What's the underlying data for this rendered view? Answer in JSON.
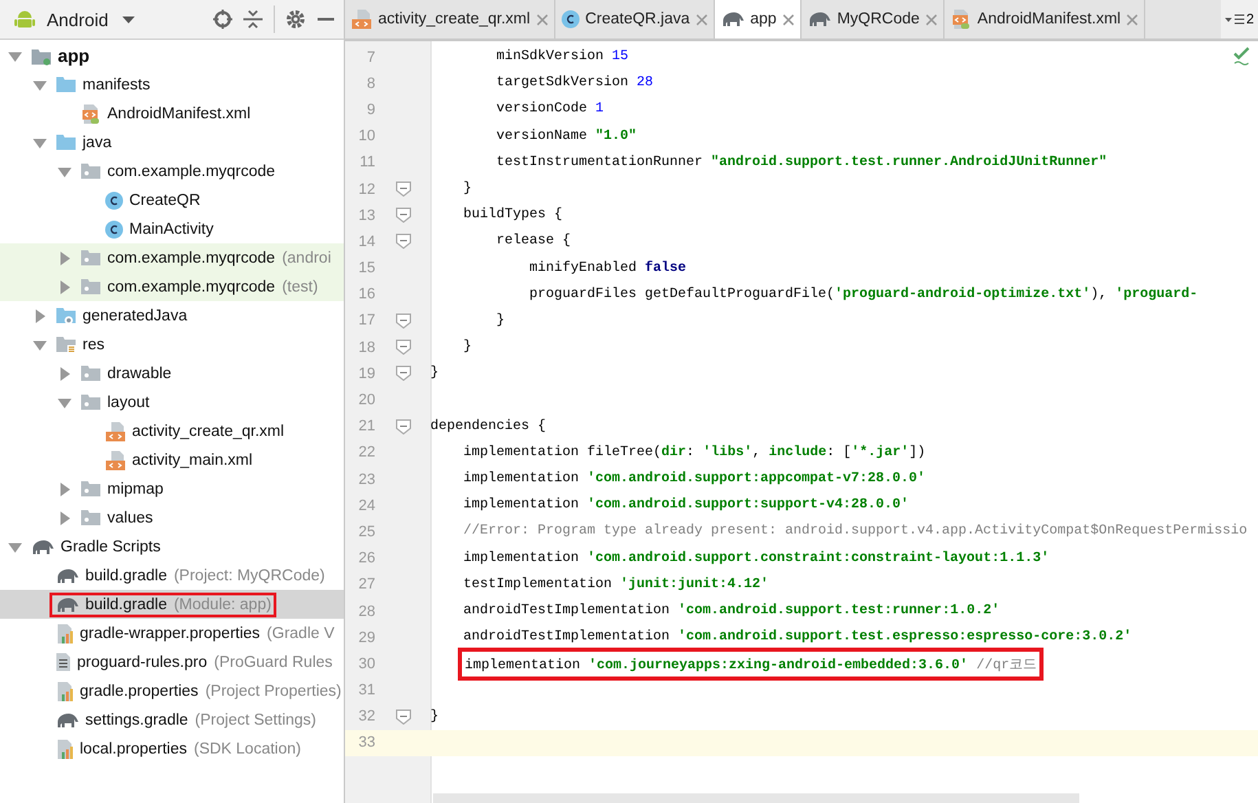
{
  "project_panel": {
    "view": "Android"
  },
  "tree": [
    {
      "label": "app",
      "kind": "module",
      "expanded": true,
      "selected": false,
      "highlighted": false,
      "boxed": false,
      "children": [
        {
          "label": "manifests",
          "kind": "folder-blue",
          "expanded": true,
          "selected": false,
          "highlighted": false,
          "boxed": false,
          "children": [
            {
              "label": "AndroidManifest.xml",
              "kind": "manifest",
              "selected": false,
              "highlighted": false,
              "boxed": false
            }
          ]
        },
        {
          "label": "java",
          "kind": "folder-blue",
          "expanded": true,
          "selected": false,
          "highlighted": false,
          "boxed": false,
          "children": [
            {
              "label": "com.example.myqrcode",
              "kind": "package",
              "expanded": true,
              "selected": false,
              "highlighted": false,
              "boxed": false,
              "children": [
                {
                  "label": "CreateQR",
                  "kind": "class",
                  "selected": false,
                  "highlighted": false,
                  "boxed": false
                },
                {
                  "label": "MainActivity",
                  "kind": "class",
                  "selected": false,
                  "highlighted": false,
                  "boxed": false
                }
              ]
            },
            {
              "label": "com.example.myqrcode",
              "hint": "(androi",
              "kind": "package",
              "expanded": false,
              "selected": false,
              "highlighted": true,
              "boxed": false
            },
            {
              "label": "com.example.myqrcode",
              "hint": "(test)",
              "kind": "package",
              "expanded": false,
              "selected": false,
              "highlighted": true,
              "boxed": false
            }
          ]
        },
        {
          "label": "generatedJava",
          "kind": "folder-gen",
          "expanded": false,
          "selected": false,
          "highlighted": false,
          "boxed": false
        },
        {
          "label": "res",
          "kind": "folder-res",
          "expanded": true,
          "selected": false,
          "highlighted": false,
          "boxed": false,
          "children": [
            {
              "label": "drawable",
              "kind": "package",
              "expanded": false,
              "selected": false,
              "highlighted": false,
              "boxed": false
            },
            {
              "label": "layout",
              "kind": "package",
              "expanded": true,
              "selected": false,
              "highlighted": false,
              "boxed": false,
              "children": [
                {
                  "label": "activity_create_qr.xml",
                  "kind": "xml",
                  "selected": false,
                  "highlighted": false,
                  "boxed": false
                },
                {
                  "label": "activity_main.xml",
                  "kind": "xml",
                  "selected": false,
                  "highlighted": false,
                  "boxed": false
                }
              ]
            },
            {
              "label": "mipmap",
              "kind": "package",
              "expanded": false,
              "selected": false,
              "highlighted": false,
              "boxed": false
            },
            {
              "label": "values",
              "kind": "package",
              "expanded": false,
              "selected": false,
              "highlighted": false,
              "boxed": false
            }
          ]
        }
      ]
    },
    {
      "label": "Gradle Scripts",
      "kind": "gradle",
      "expanded": true,
      "selected": false,
      "highlighted": false,
      "boxed": false,
      "children": [
        {
          "label": "build.gradle",
          "hint": "(Project: MyQRCode)",
          "kind": "gradle",
          "selected": false,
          "highlighted": false,
          "boxed": false
        },
        {
          "label": "build.gradle",
          "hint": "(Module: app)",
          "kind": "gradle",
          "selected": true,
          "highlighted": false,
          "boxed": true
        },
        {
          "label": "gradle-wrapper.properties",
          "hint": "(Gradle V",
          "kind": "props",
          "selected": false,
          "highlighted": false,
          "boxed": false
        },
        {
          "label": "proguard-rules.pro",
          "hint": "(ProGuard Rules",
          "kind": "text",
          "selected": false,
          "highlighted": false,
          "boxed": false
        },
        {
          "label": "gradle.properties",
          "hint": "(Project Properties)",
          "kind": "props",
          "selected": false,
          "highlighted": false,
          "boxed": false
        },
        {
          "label": "settings.gradle",
          "hint": "(Project Settings)",
          "kind": "gradle",
          "selected": false,
          "highlighted": false,
          "boxed": false
        },
        {
          "label": "local.properties",
          "hint": "(SDK Location)",
          "kind": "props",
          "selected": false,
          "highlighted": false,
          "boxed": false
        }
      ]
    }
  ],
  "tabs": [
    {
      "label": "activity_create_qr.xml",
      "kind": "xml",
      "selected": false
    },
    {
      "label": "CreateQR.java",
      "kind": "class",
      "selected": false
    },
    {
      "label": "app",
      "kind": "gradle",
      "selected": true
    },
    {
      "label": "MyQRCode",
      "kind": "gradle",
      "selected": false
    },
    {
      "label": "AndroidManifest.xml",
      "kind": "manifest",
      "selected": false
    }
  ],
  "tab_overflow_count": "2",
  "code_lines": [
    {
      "number": "7",
      "fold": false,
      "current": false,
      "boxed": false,
      "segments": [
        {
          "text": "        minSdkVersion ",
          "kind": "plain"
        },
        {
          "text": "15",
          "kind": "number"
        }
      ]
    },
    {
      "number": "8",
      "fold": false,
      "current": false,
      "boxed": false,
      "segments": [
        {
          "text": "        targetSdkVersion ",
          "kind": "plain"
        },
        {
          "text": "28",
          "kind": "number"
        }
      ]
    },
    {
      "number": "9",
      "fold": false,
      "current": false,
      "boxed": false,
      "segments": [
        {
          "text": "        versionCode ",
          "kind": "plain"
        },
        {
          "text": "1",
          "kind": "number"
        }
      ]
    },
    {
      "number": "10",
      "fold": false,
      "current": false,
      "boxed": false,
      "segments": [
        {
          "text": "        versionName ",
          "kind": "plain"
        },
        {
          "text": "\"1.0\"",
          "kind": "string"
        }
      ]
    },
    {
      "number": "11",
      "fold": false,
      "current": false,
      "boxed": false,
      "segments": [
        {
          "text": "        testInstrumentationRunner ",
          "kind": "plain"
        },
        {
          "text": "\"android.support.test.runner.AndroidJUnitRunner\"",
          "kind": "string"
        }
      ]
    },
    {
      "number": "12",
      "fold": true,
      "current": false,
      "boxed": false,
      "segments": [
        {
          "text": "    }",
          "kind": "plain"
        }
      ]
    },
    {
      "number": "13",
      "fold": true,
      "current": false,
      "boxed": false,
      "segments": [
        {
          "text": "    buildTypes {",
          "kind": "plain"
        }
      ]
    },
    {
      "number": "14",
      "fold": true,
      "current": false,
      "boxed": false,
      "segments": [
        {
          "text": "        release {",
          "kind": "plain"
        }
      ]
    },
    {
      "number": "15",
      "fold": false,
      "current": false,
      "boxed": false,
      "segments": [
        {
          "text": "            minifyEnabled ",
          "kind": "plain"
        },
        {
          "text": "false",
          "kind": "keyword"
        }
      ]
    },
    {
      "number": "16",
      "fold": false,
      "current": false,
      "boxed": false,
      "segments": [
        {
          "text": "            proguardFiles getDefaultProguardFile(",
          "kind": "plain"
        },
        {
          "text": "'proguard-android-optimize.txt'",
          "kind": "string"
        },
        {
          "text": "), ",
          "kind": "plain"
        },
        {
          "text": "'proguard-",
          "kind": "string"
        }
      ]
    },
    {
      "number": "17",
      "fold": true,
      "current": false,
      "boxed": false,
      "segments": [
        {
          "text": "        }",
          "kind": "plain"
        }
      ]
    },
    {
      "number": "18",
      "fold": true,
      "current": false,
      "boxed": false,
      "segments": [
        {
          "text": "    }",
          "kind": "plain"
        }
      ]
    },
    {
      "number": "19",
      "fold": true,
      "current": false,
      "boxed": false,
      "segments": [
        {
          "text": "}",
          "kind": "plain"
        }
      ]
    },
    {
      "number": "20",
      "fold": false,
      "current": false
    },
    {
      "number": "21",
      "fold": true,
      "current": false,
      "boxed": false,
      "segments": [
        {
          "text": "dependencies {",
          "kind": "plain"
        }
      ]
    },
    {
      "number": "22",
      "fold": false,
      "current": false,
      "boxed": false,
      "segments": [
        {
          "text": "    implementation fileTree(",
          "kind": "plain"
        },
        {
          "text": "dir",
          "kind": "string"
        },
        {
          "text": ": ",
          "kind": "plain"
        },
        {
          "text": "'libs'",
          "kind": "string"
        },
        {
          "text": ", ",
          "kind": "plain"
        },
        {
          "text": "include",
          "kind": "string"
        },
        {
          "text": ": [",
          "kind": "plain"
        },
        {
          "text": "'*.jar'",
          "kind": "string"
        },
        {
          "text": "])",
          "kind": "plain"
        }
      ]
    },
    {
      "number": "23",
      "fold": false,
      "current": false,
      "boxed": false,
      "segments": [
        {
          "text": "    implementation ",
          "kind": "plain"
        },
        {
          "text": "'com.android.support:appcompat-v7:28.0.0'",
          "kind": "string"
        }
      ]
    },
    {
      "number": "24",
      "fold": false,
      "current": false,
      "boxed": false,
      "segments": [
        {
          "text": "    implementation ",
          "kind": "plain"
        },
        {
          "text": "'com.android.support:support-v4:28.0.0'",
          "kind": "string"
        }
      ]
    },
    {
      "number": "25",
      "fold": false,
      "current": false,
      "boxed": false,
      "segments": [
        {
          "text": "    //Error: Program type already present: android.support.v4.app.ActivityCompat$OnRequestPermissio",
          "kind": "comment"
        }
      ]
    },
    {
      "number": "26",
      "fold": false,
      "current": false,
      "boxed": false,
      "segments": [
        {
          "text": "    implementation ",
          "kind": "plain"
        },
        {
          "text": "'com.android.support.constraint:constraint-layout:1.1.3'",
          "kind": "string"
        }
      ]
    },
    {
      "number": "27",
      "fold": false,
      "current": false,
      "boxed": false,
      "segments": [
        {
          "text": "    testImplementation ",
          "kind": "plain"
        },
        {
          "text": "'junit:junit:4.12'",
          "kind": "string"
        }
      ]
    },
    {
      "number": "28",
      "fold": false,
      "current": false,
      "boxed": false,
      "segments": [
        {
          "text": "    androidTestImplementation ",
          "kind": "plain"
        },
        {
          "text": "'com.android.support.test:runner:1.0.2'",
          "kind": "string"
        }
      ]
    },
    {
      "number": "29",
      "fold": false,
      "current": false,
      "boxed": false,
      "segments": [
        {
          "text": "    androidTestImplementation ",
          "kind": "plain"
        },
        {
          "text": "'com.android.support.test.espresso:espresso-core:3.0.2'",
          "kind": "string"
        }
      ]
    },
    {
      "number": "30",
      "fold": false,
      "current": false,
      "boxed": true,
      "segments": [
        {
          "text": "    implementation ",
          "kind": "plain"
        },
        {
          "text": "'com.journeyapps:zxing-android-embedded:3.6.0'",
          "kind": "string"
        },
        {
          "text": " //qr코드",
          "kind": "comment"
        }
      ]
    },
    {
      "number": "31",
      "fold": false,
      "current": false
    },
    {
      "number": "32",
      "fold": true,
      "current": false,
      "boxed": false,
      "segments": [
        {
          "text": "}",
          "kind": "plain"
        }
      ]
    },
    {
      "number": "33",
      "fold": false,
      "current": true
    }
  ]
}
